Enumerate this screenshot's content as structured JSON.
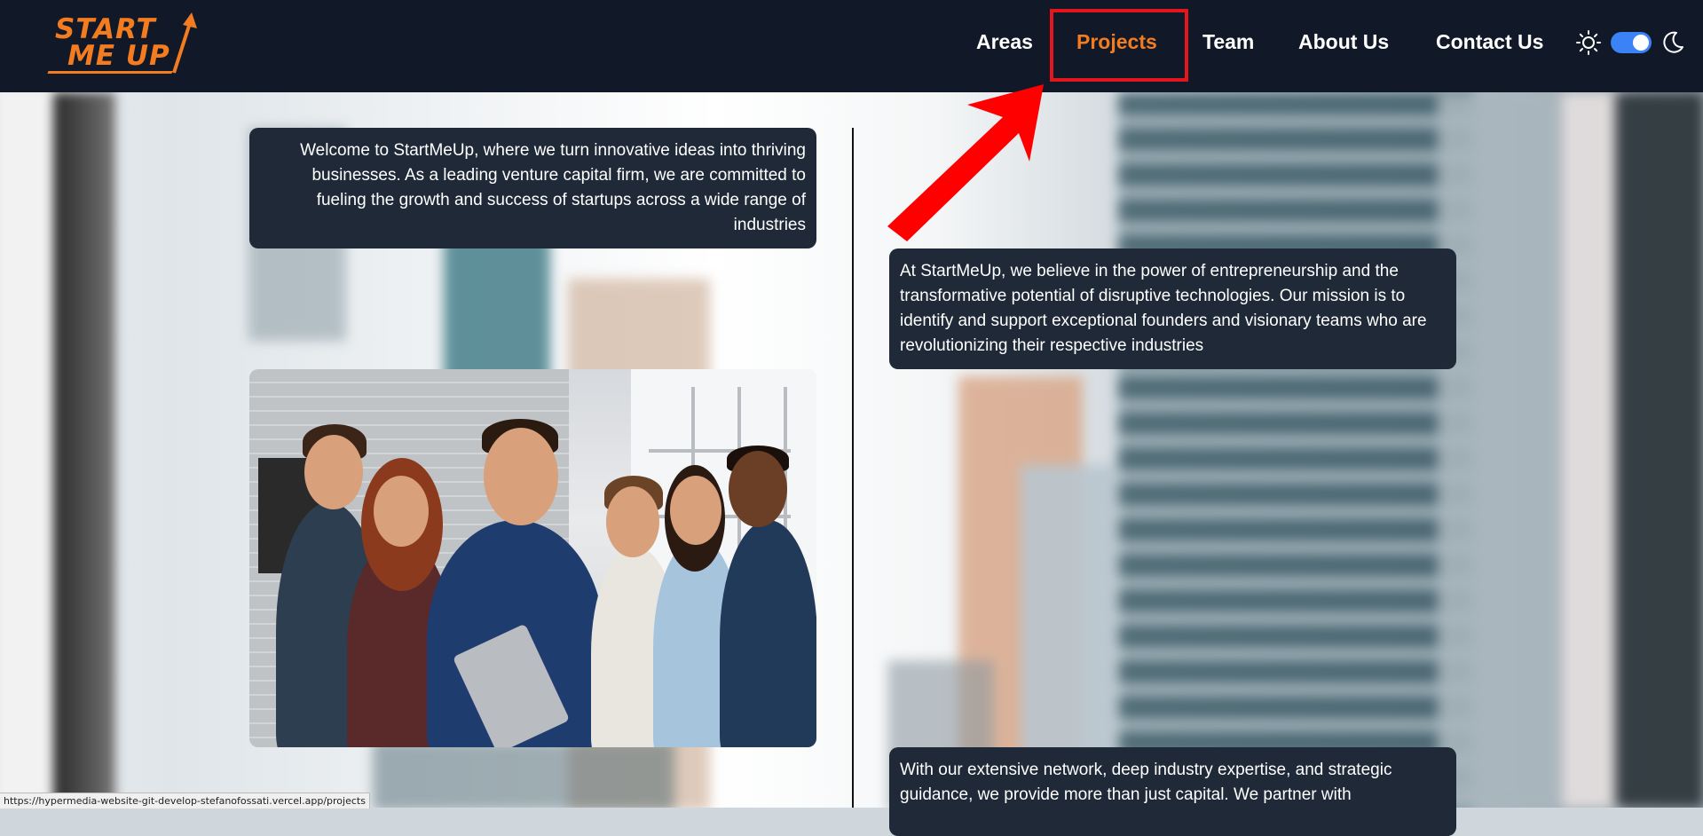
{
  "brand": {
    "logo_line1": "START",
    "logo_line2": "ME UP",
    "accent_color": "#f47c20"
  },
  "nav": {
    "items": [
      {
        "label": "Areas",
        "active": false
      },
      {
        "label": "Projects",
        "active": true
      },
      {
        "label": "Team",
        "active": false
      },
      {
        "label": "About Us",
        "active": false
      },
      {
        "label": "Contact Us",
        "active": false
      }
    ],
    "theme_toggle": {
      "light_icon": "sun-icon",
      "dark_icon": "moon-icon",
      "state": "dark",
      "switch_color": "#3b82f6"
    }
  },
  "content": {
    "intro": "Welcome to StartMeUp, where we turn innovative ideas into thriving businesses. As a leading venture capital firm, we are committed to fueling the growth and success of startups across a wide range of industries",
    "mission": "At StartMeUp, we believe in the power of entrepreneurship and the transformative potential of disruptive technologies. Our mission is to identify and support exceptional founders and visionary teams who are revolutionizing their respective industries",
    "network": "With our extensive network, deep industry expertise, and strategic guidance, we provide more than just capital. We partner with",
    "team_photo_icon": "team-photo"
  },
  "annotation": {
    "highlight_color": "#e3161c",
    "target": "Projects"
  },
  "status_bar": {
    "url": "https://hypermedia-website-git-develop-stefanofossati.vercel.app/projects"
  }
}
